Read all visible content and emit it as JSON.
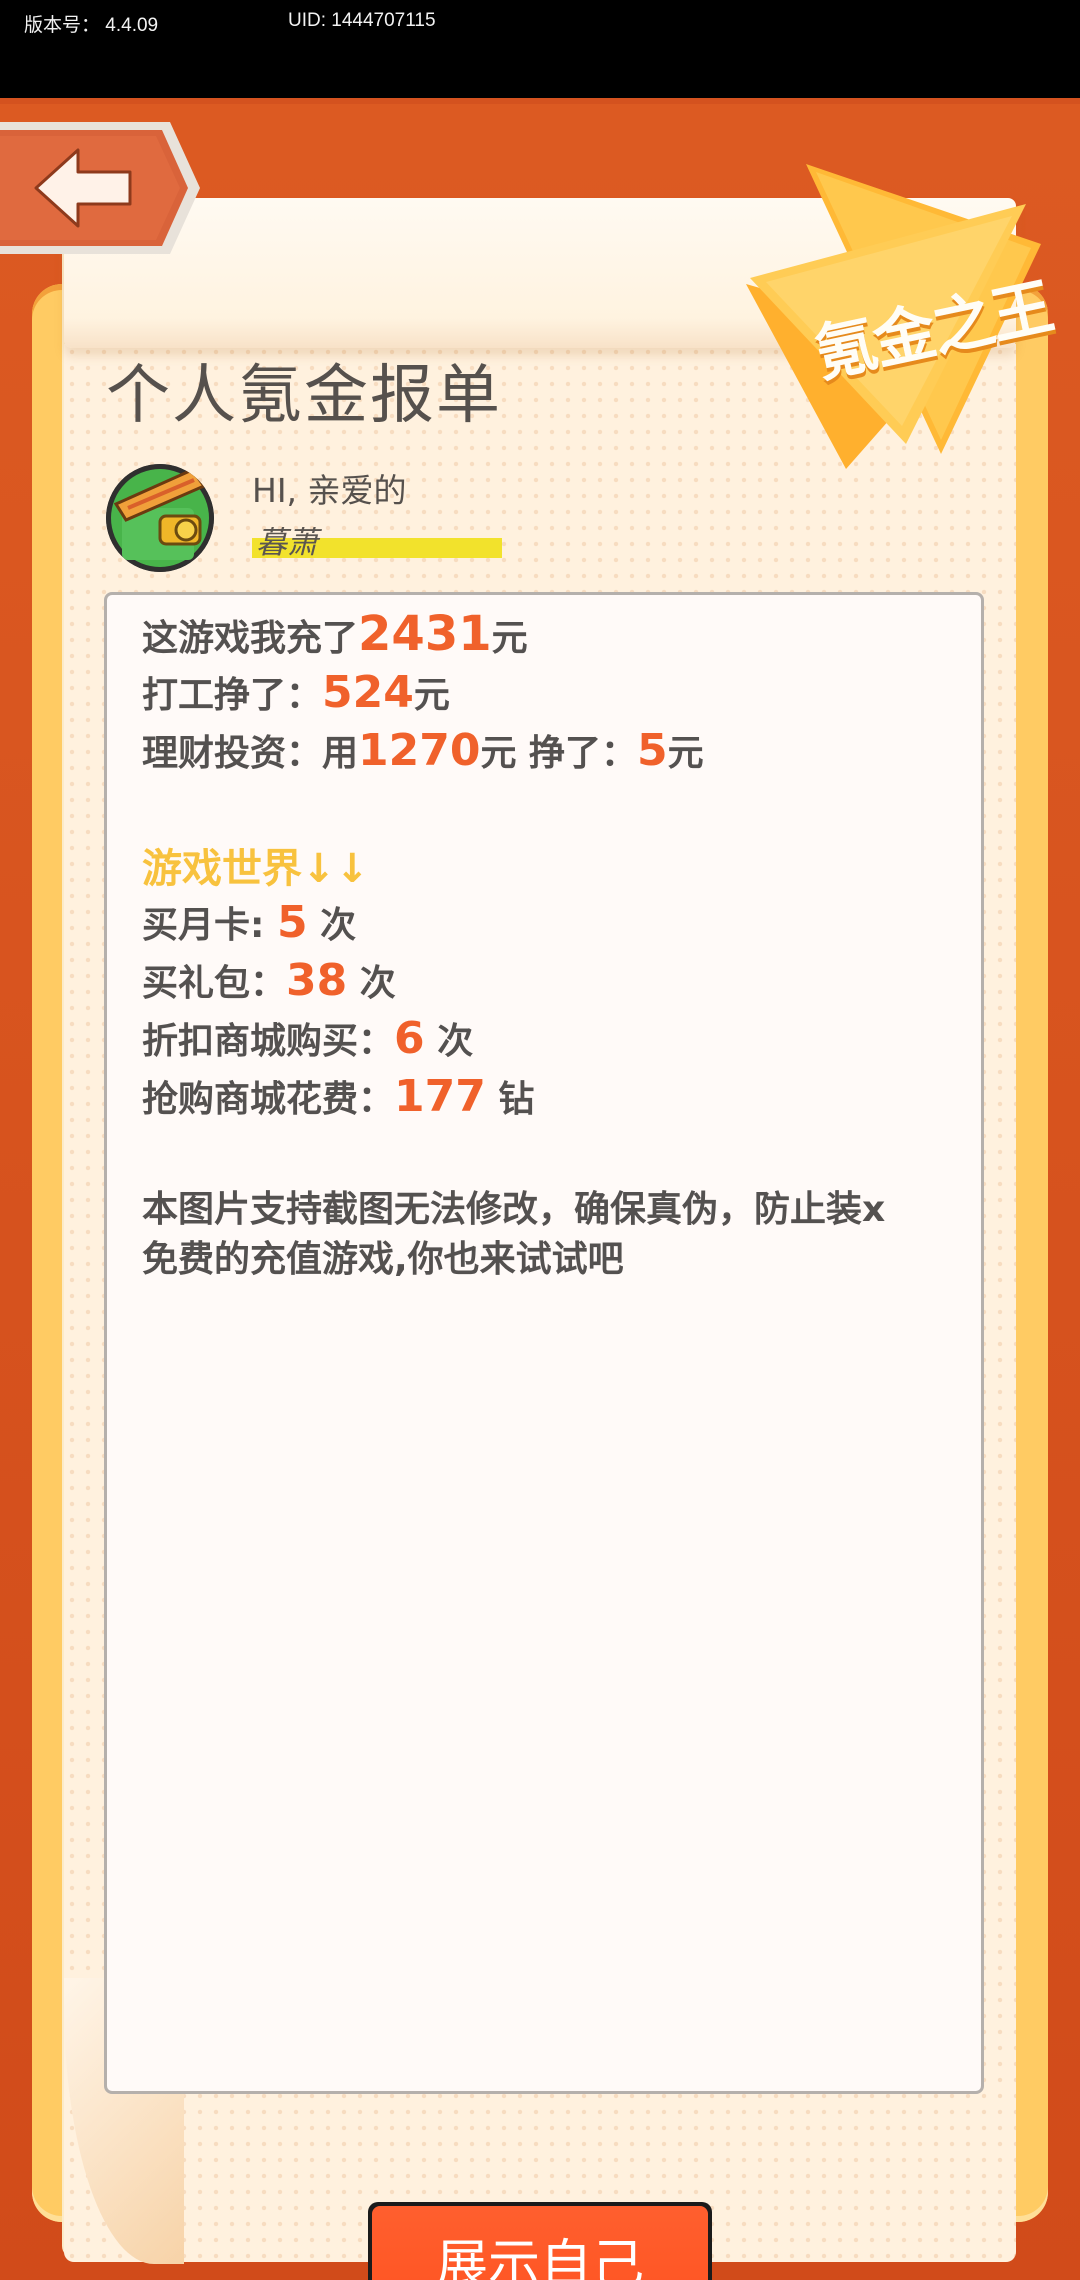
{
  "status": {
    "version_label": "版本号：  4.4.09",
    "uid_label": "UID: 1444707115"
  },
  "header": {
    "title": "个人氪金报单",
    "badge_text": "氪金之王"
  },
  "profile": {
    "greeting": "HI, 亲爱的",
    "username": "暮萧"
  },
  "report": {
    "total": {
      "prefix": "这游戏我充了",
      "amount": "2431",
      "unit": "元"
    },
    "work": {
      "prefix": "打工挣了：",
      "amount": "524",
      "unit": "元"
    },
    "invest": {
      "prefix": "理财投资：用",
      "amount": "1270",
      "mid": "元  挣了：",
      "earned": "5",
      "unit": "元"
    },
    "section_title": "游戏世界↓↓",
    "monthly_card": {
      "prefix": "买月卡:",
      "count": "5",
      "unit": "次"
    },
    "gift_pack": {
      "prefix": "买礼包：",
      "count": "38",
      "unit": "次"
    },
    "discount_shop": {
      "prefix": "折扣商城购买：",
      "count": "6",
      "unit": "次"
    },
    "flash_shop": {
      "prefix": "抢购商城花费：",
      "count": "177",
      "unit": "钻"
    },
    "note_line1": "本图片支持截图无法修改，确保真伪，防止装x",
    "note_line2": "免费的充值游戏,你也来试试吧"
  },
  "actions": {
    "show_label": "展示自己"
  },
  "colors": {
    "accent": "#f0612b",
    "section": "#f8c23e",
    "background": "#d4521f",
    "button": "#ff5a28",
    "highlight": "#f2e22c"
  },
  "icons": {
    "back": "back-arrow-icon",
    "badge": "star-badge-icon",
    "avatar": "game-avatar-icon"
  }
}
